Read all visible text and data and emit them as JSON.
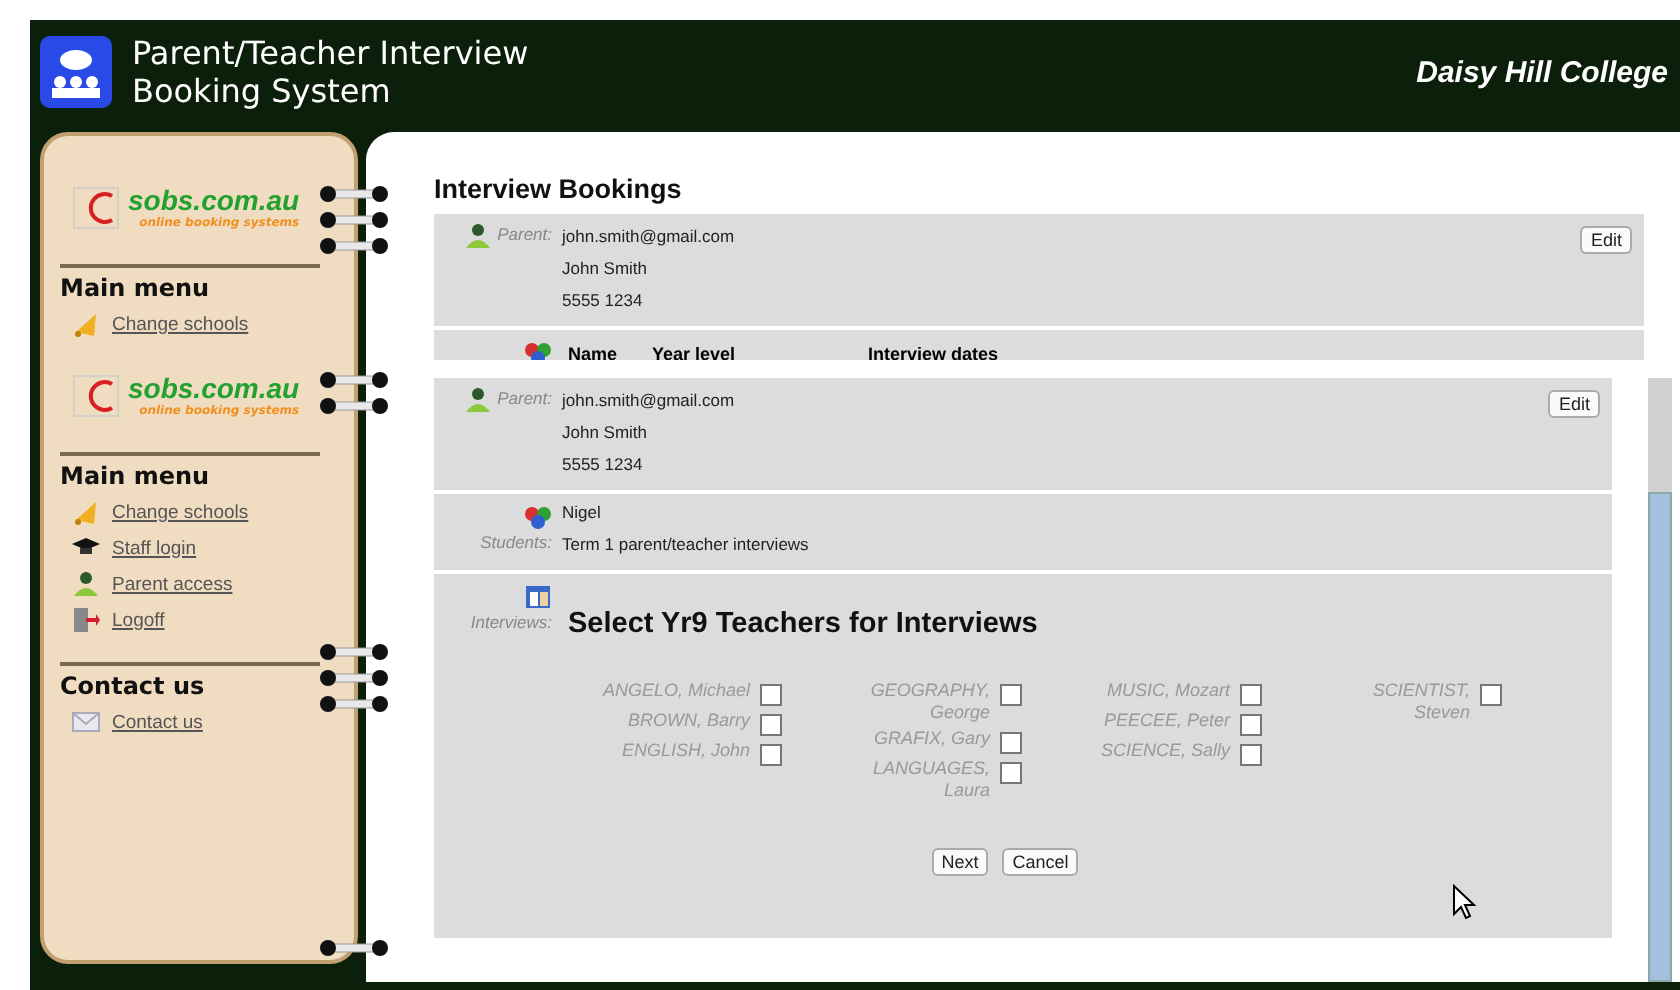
{
  "header": {
    "title_lines": [
      "Parent/Teacher Interview",
      "Booking System"
    ],
    "school": "Daisy Hill College"
  },
  "sidebar_back": {
    "logo": {
      "name": "sobs.com.au",
      "tagline": "online booking systems"
    },
    "sections": [
      {
        "heading": "Main menu",
        "items": [
          {
            "label": "Change schools",
            "kind": "bell"
          }
        ]
      }
    ]
  },
  "sidebar_front": {
    "logo": {
      "name": "sobs.com.au",
      "tagline": "online booking systems"
    },
    "sections": [
      {
        "heading": "Main menu",
        "items": [
          {
            "label": "Change schools",
            "kind": "bell"
          },
          {
            "label": "Staff login",
            "kind": "cap"
          },
          {
            "label": "Parent access",
            "kind": "person"
          },
          {
            "label": "Logoff",
            "kind": "door"
          }
        ]
      },
      {
        "heading": "Contact us",
        "items": [
          {
            "label": "Contact us",
            "kind": "mail"
          }
        ]
      }
    ]
  },
  "page_back": {
    "title": "Interview Bookings",
    "parent": {
      "label": "Parent:",
      "lines": [
        "john.smith@gmail.com",
        "John Smith",
        "5555 1234"
      ],
      "button": "Edit"
    },
    "student_columns": [
      "Name",
      "Year level",
      "Interview dates"
    ]
  },
  "page_front": {
    "parent": {
      "label": "Parent:",
      "lines": [
        "john.smith@gmail.com",
        "John Smith",
        "5555 1234"
      ],
      "button": "Edit"
    },
    "students": {
      "label": "Students:",
      "lines": [
        "Nigel",
        "Term 1 parent/teacher interviews"
      ]
    },
    "interviews": {
      "label": "Interviews:",
      "heading": "Select Yr9 Teachers for Interviews",
      "columns": [
        [
          {
            "name": "ANGELO, Michael",
            "checked": false
          },
          {
            "name": "BROWN, Barry",
            "checked": false
          },
          {
            "name": "ENGLISH, John",
            "checked": false
          }
        ],
        [
          {
            "name": "GEOGRAPHY, George",
            "checked": false
          },
          {
            "name": "GRAFIX, Gary",
            "checked": false
          },
          {
            "name": "LANGUAGES, Laura",
            "checked": false
          }
        ],
        [
          {
            "name": "MUSIC, Mozart",
            "checked": false
          },
          {
            "name": "PEECEE, Peter",
            "checked": false
          },
          {
            "name": "SCIENCE, Sally",
            "checked": false
          }
        ],
        [
          {
            "name": "SCIENTIST, Steven",
            "checked": false
          }
        ]
      ],
      "buttons": [
        "Next",
        "Cancel"
      ]
    }
  }
}
